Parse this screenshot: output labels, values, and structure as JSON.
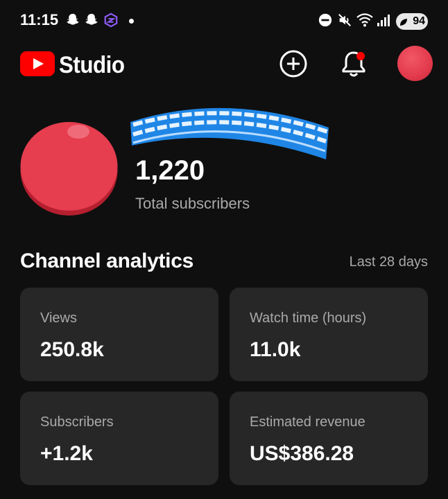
{
  "status_bar": {
    "time": "11:15",
    "battery": "94"
  },
  "app_bar": {
    "logo_text": "Studio"
  },
  "channel": {
    "subscriber_count": "1,220",
    "subscriber_label": "Total subscribers"
  },
  "analytics": {
    "title": "Channel analytics",
    "range": "Last 28 days",
    "cards": [
      {
        "label": "Views",
        "value": "250.8k"
      },
      {
        "label": "Watch time (hours)",
        "value": "11.0k"
      },
      {
        "label": "Subscribers",
        "value": "+1.2k"
      },
      {
        "label": "Estimated revenue",
        "value": "US$386.28"
      }
    ]
  },
  "colors": {
    "background": "#0f0f0f",
    "card": "#272727",
    "brand_red": "#ff0000",
    "avatar_red": "#e23a4c",
    "notification_dot": "#ff0000"
  },
  "icons": [
    "snapchat-icon",
    "snapchat-icon",
    "app-icon",
    "dnd-icon",
    "mute-icon",
    "wifi-icon",
    "signal-icon",
    "battery-icon",
    "create-icon",
    "notifications-icon"
  ]
}
